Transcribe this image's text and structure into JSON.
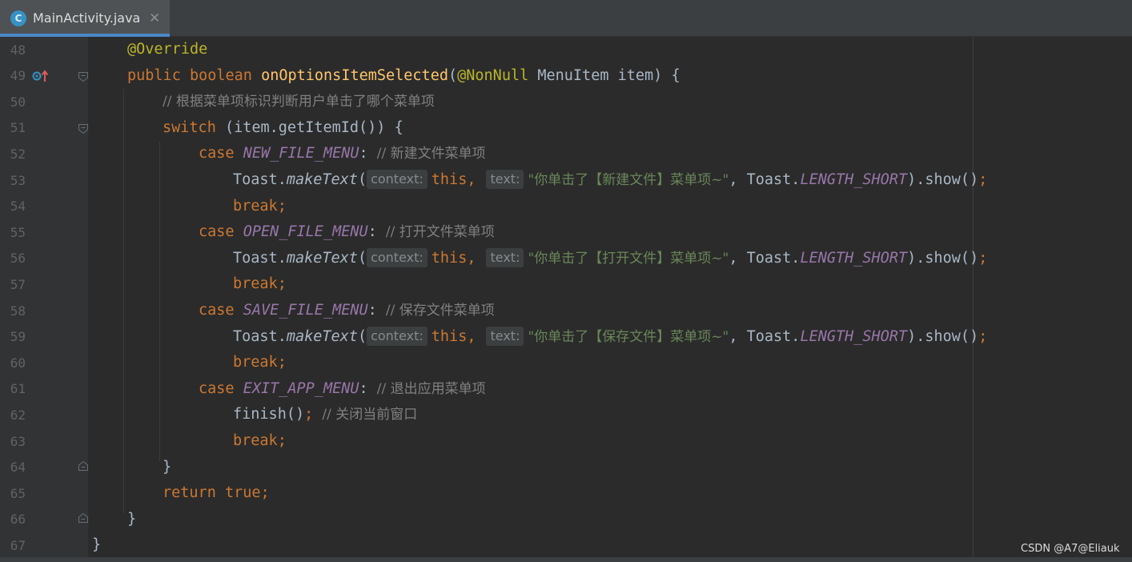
{
  "tab": {
    "icon_letter": "C",
    "title": "MainActivity.java",
    "close": "✕"
  },
  "line_numbers": [
    "48",
    "49",
    "50",
    "51",
    "52",
    "53",
    "54",
    "55",
    "56",
    "57",
    "58",
    "59",
    "60",
    "61",
    "62",
    "63",
    "64",
    "65",
    "66",
    "67"
  ],
  "code": {
    "override": "@Override",
    "kw_public": "public",
    "kw_boolean": "boolean",
    "method_name": "onOptionsItemSelected",
    "paren_open": "(",
    "nonnull": "@NonNull",
    "param": " MenuItem item) {",
    "comment_switch": "// 根据菜单项标识判断用户单击了哪个菜单项",
    "kw_switch": "switch",
    "switch_expr": " (item.getItemId()) {",
    "kw_case": "case",
    "colon": ":",
    "case_new": "NEW_FILE_MENU",
    "comment_new": "// 新建文件菜单项",
    "case_open": "OPEN_FILE_MENU",
    "comment_open": "// 打开文件菜单项",
    "case_save": "SAVE_FILE_MENU",
    "comment_save": "// 保存文件菜单项",
    "case_exit": "EXIT_APP_MENU",
    "comment_exit": "// 退出应用菜单项",
    "toast": "Toast.",
    "make_text": "makeText",
    "hint_context": "context:",
    "kw_this": "this",
    "comma": ",",
    "hint_text": "text:",
    "str_new": "\"你单击了【新建文件】菜单项~\"",
    "str_open": "\"你单击了【打开文件】菜单项~\"",
    "str_save": "\"你单击了【保存文件】菜单项~\"",
    "toast_const_prefix": ", Toast.",
    "length_short": "LENGTH_SHORT",
    "show_call": ").show()",
    "semicolon": ";",
    "kw_break": "break",
    "finish_call": "finish()",
    "comment_finish": "// 关闭当前窗口",
    "close_brace": "}",
    "kw_return": "return",
    "kw_true": "true"
  },
  "watermark": "CSDN @A7@Eliauk",
  "colors": {
    "background": "#2b2b2b",
    "gutter": "#313335",
    "keyword": "#cc7832",
    "annotation": "#bbb529",
    "method": "#ffc66d",
    "comment": "#808080",
    "string": "#6a8759",
    "constant": "#9876aa",
    "text": "#a9b7c6",
    "tab_underline": "#4a88c7"
  }
}
